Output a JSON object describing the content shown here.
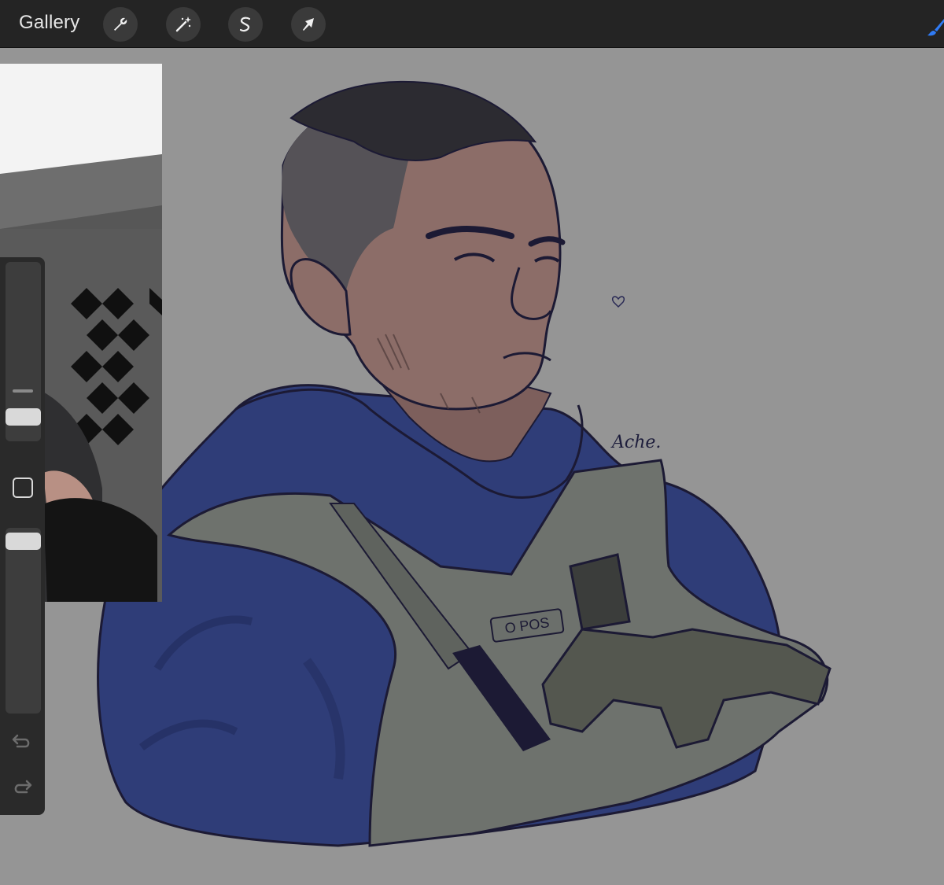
{
  "toolbar": {
    "gallery_label": "Gallery",
    "tools": [
      {
        "name": "actions",
        "icon": "wrench-icon"
      },
      {
        "name": "adjustments",
        "icon": "magic-wand-icon"
      },
      {
        "name": "selection",
        "icon": "selection-s-icon"
      },
      {
        "name": "transform",
        "icon": "arrow-cursor-icon"
      }
    ],
    "brush_icon": "paintbrush-icon",
    "accent_color": "#2f7bf5"
  },
  "sidebar": {
    "brush_size_level": 0.33,
    "opacity_level": 0.82,
    "undo_icon": "undo-arrow-icon",
    "redo_icon": "redo-arrow-icon"
  },
  "artwork": {
    "signature": "Ache.",
    "vest_patch": "O POS",
    "colors": {
      "background": "#959595",
      "hoodie": "#2f3d78",
      "skin": "#8c6d68",
      "vest": "#6e726d",
      "lineart": "#1c1a34"
    }
  }
}
